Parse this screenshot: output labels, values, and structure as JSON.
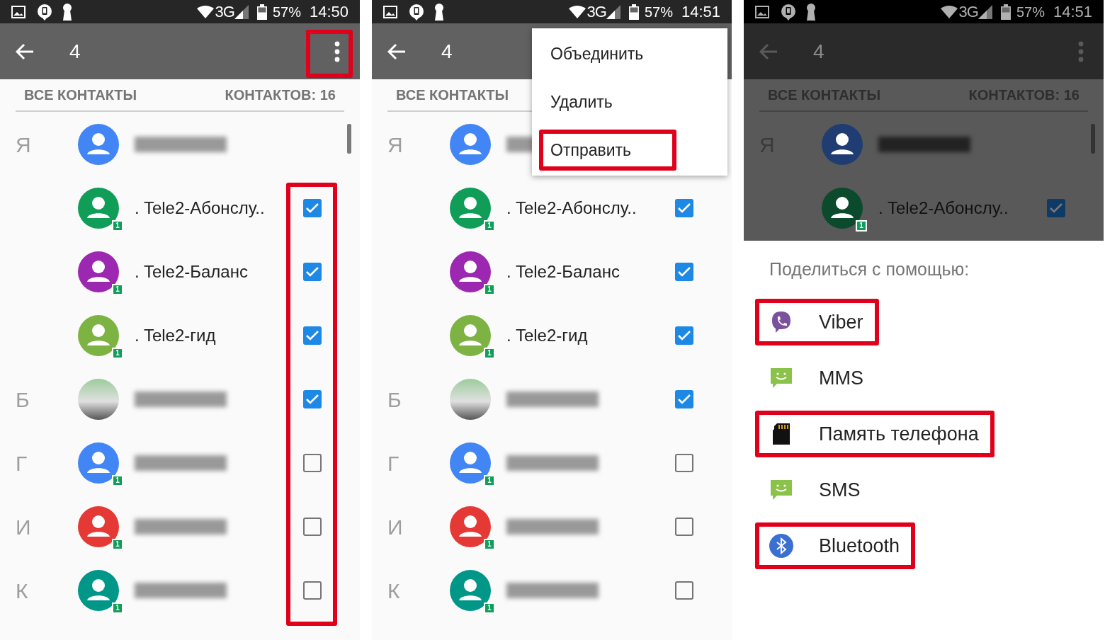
{
  "panels": [
    {
      "status_bar": {
        "network": "3G",
        "battery": "57%",
        "time": "14:50"
      },
      "toolbar": {
        "count": "4",
        "more_highlighted": true
      },
      "header": {
        "left": "ВСЕ КОНТАКТЫ",
        "right": "КОНТАКТОВ: 16"
      },
      "checkboxes_highlighted": true,
      "scrollbar": true,
      "rows": [
        {
          "kind": "profile",
          "letter": "Я",
          "color": "#4285f4",
          "name_blurred": true
        },
        {
          "kind": "contact",
          "color": "#0f9d58",
          "sim": "1",
          "name": ". Tele2-Абонслу..",
          "checked": true
        },
        {
          "kind": "contact",
          "color": "#9c27b0",
          "sim": "1",
          "name": ". Tele2-Баланс",
          "checked": true
        },
        {
          "kind": "contact",
          "color": "#7cb342",
          "sim": "1",
          "name": ". Tele2-гид",
          "checked": true
        },
        {
          "kind": "contact",
          "letter": "Б",
          "photo": true,
          "name_blurred": true,
          "checked": true
        },
        {
          "kind": "contact",
          "letter": "Г",
          "color": "#4285f4",
          "sim": "1",
          "name_blurred": true,
          "checked": false
        },
        {
          "kind": "contact",
          "letter": "И",
          "color": "#e53935",
          "sim": "1",
          "name_blurred": true,
          "checked": false
        },
        {
          "kind": "contact",
          "letter": "К",
          "color": "#009688",
          "sim": "1",
          "name_blurred": true,
          "checked": false
        }
      ]
    },
    {
      "status_bar": {
        "network": "3G",
        "battery": "57%",
        "time": "14:51"
      },
      "toolbar": {
        "count": "4"
      },
      "header": {
        "left": "ВСЕ КОНТАКТЫ"
      },
      "menu": [
        {
          "label": "Объединить",
          "highlighted": false
        },
        {
          "label": "Удалить",
          "highlighted": false
        },
        {
          "label": "Отправить",
          "highlighted": true
        }
      ],
      "rows": [
        {
          "kind": "profile",
          "letter": "Я",
          "color": "#4285f4",
          "name_blurred": true
        },
        {
          "kind": "contact",
          "color": "#0f9d58",
          "sim": "1",
          "name": ". Tele2-Абонслу..",
          "checked": true
        },
        {
          "kind": "contact",
          "color": "#9c27b0",
          "sim": "1",
          "name": ". Tele2-Баланс",
          "checked": true
        },
        {
          "kind": "contact",
          "color": "#7cb342",
          "sim": "1",
          "name": ". Tele2-гид",
          "checked": true
        },
        {
          "kind": "contact",
          "letter": "Б",
          "photo": true,
          "name_blurred": true,
          "checked": true
        },
        {
          "kind": "contact",
          "letter": "Г",
          "color": "#4285f4",
          "sim": "1",
          "name_blurred": true,
          "checked": false
        },
        {
          "kind": "contact",
          "letter": "И",
          "color": "#e53935",
          "sim": "1",
          "name_blurred": true,
          "checked": false
        },
        {
          "kind": "contact",
          "letter": "К",
          "color": "#009688",
          "sim": "1",
          "name_blurred": true,
          "checked": false
        }
      ]
    },
    {
      "dimmed": true,
      "status_bar": {
        "network": "3G",
        "battery": "57%",
        "time": "14:51"
      },
      "toolbar": {
        "count": "4"
      },
      "header": {
        "left": "ВСЕ КОНТАКТЫ",
        "right": "КОНТАКТОВ: 16"
      },
      "scrollbar": true,
      "rows": [
        {
          "kind": "profile",
          "letter": "Я",
          "color": "#1f3d73",
          "name_blurred": true
        },
        {
          "kind": "contact",
          "color": "#0b4a2c",
          "sim": "1",
          "name": ". Tele2-Абонслу..",
          "checked": true
        }
      ],
      "share": {
        "title": "Поделиться с помощью:",
        "items": [
          {
            "kind": "viber",
            "label": "Viber",
            "highlighted": true
          },
          {
            "kind": "message",
            "label": "MMS",
            "highlighted": false
          },
          {
            "kind": "sdcard",
            "label": "Память телефона",
            "highlighted": true
          },
          {
            "kind": "message",
            "label": "SMS",
            "highlighted": false
          },
          {
            "kind": "bluetooth",
            "label": "Bluetooth",
            "highlighted": true
          }
        ]
      }
    }
  ]
}
